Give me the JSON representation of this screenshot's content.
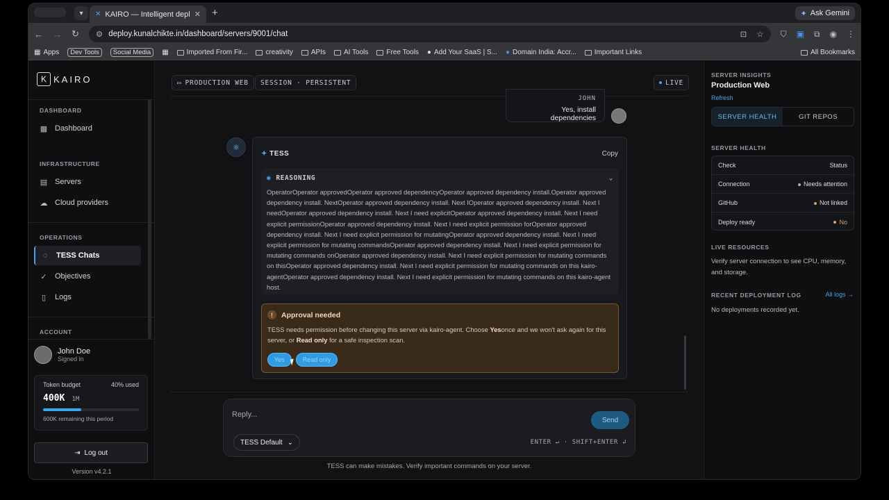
{
  "browser": {
    "tab_title": "KAIRO — Intelligent deployment",
    "new_tab": "+",
    "ask_gemini": "Ask Gemini",
    "url": "deploy.kunalchikte.in/dashboard/servers/9001/chat"
  },
  "bookmarks": {
    "items": [
      "Apps",
      "Dev Tools",
      "Social Media",
      "Imported From Fir...",
      "creativity",
      "APIs",
      "AI Tools",
      "Free Tools",
      "Add Your SaaS | S...",
      "Domain India: Accr...",
      "Important Links"
    ],
    "all": "All Bookmarks"
  },
  "sidebar": {
    "logo": "KAIRO",
    "logo_mark": "K",
    "sections": {
      "dashboard": "DASHBOARD",
      "infrastructure": "INFRASTRUCTURE",
      "operations": "OPERATIONS",
      "account": "ACCOUNT"
    },
    "items": {
      "dashboard": "Dashboard",
      "servers": "Servers",
      "cloud": "Cloud providers",
      "tess": "TESS Chats",
      "objectives": "Objectives",
      "logs": "Logs"
    },
    "user": {
      "name": "John Doe",
      "status": "Signed in"
    },
    "budget": {
      "label": "Token budget",
      "used": "40% used",
      "used_fraction": 0.4,
      "value": "400K",
      "limit": "1M",
      "remaining": "600K remaining this period"
    },
    "logout": "Log out",
    "version": "Version v4.2.1"
  },
  "main": {
    "chip_server": "PRODUCTION WEB",
    "chip_session": "SESSION · PERSISTENT",
    "chip_live": "LIVE",
    "user_msg": {
      "name": "JOHN",
      "text": "Yes, install dependencies"
    },
    "assistant": {
      "name": "TESS",
      "copy": "Copy",
      "reasoning_label": "REASONING",
      "reasoning_text": "OperatorOperator approvedOperator approved dependencyOperator approved dependency install.Operator approved dependency install. NextOperator approved dependency install. Next IOperator approved dependency install. Next I needOperator approved dependency install. Next I need explicitOperator approved dependency install. Next I need explicit permissionOperator approved dependency install. Next I need explicit permission forOperator approved dependency install. Next I need explicit permission for mutatingOperator approved dependency install. Next I need explicit permission for mutating commandsOperator approved dependency install. Next I need explicit permission for mutating commands onOperator approved dependency install. Next I need explicit permission for mutating commands on thisOperator approved dependency install. Next I need explicit permission for mutating commands on this kairo-agentOperator approved dependency install. Next I need explicit permission for mutating commands on this kairo-agent host.",
      "approval": {
        "title": "Approval needed",
        "text_1": "TESS needs permission before changing this server via kairo-agent. Choose ",
        "text_yes": "Yes",
        "text_2": "once and we won't ask again for this server, or ",
        "text_readonly": "Read only",
        "text_3": " for a safe inspection scan.",
        "btn_yes": "Yes",
        "btn_readonly": "Read only"
      }
    },
    "composer": {
      "placeholder": "Reply...",
      "send": "Send",
      "model": "TESS Default",
      "hints": "ENTER ↵ · SHIFT+ENTER ↲"
    },
    "disclaimer": "TESS can make mistakes. Verify important commands on your server."
  },
  "right": {
    "eyebrow": "SERVER INSIGHTS",
    "title": "Production Web",
    "refresh": "Refresh",
    "tab_health": "SERVER HEALTH",
    "tab_git": "GIT REPOS",
    "health_title": "SERVER HEALTH",
    "health_header": {
      "check": "Check",
      "status": "Status"
    },
    "health_rows": [
      {
        "check": "Connection",
        "status": "Needs attention"
      },
      {
        "check": "GitHub",
        "status": "Not linked"
      },
      {
        "check": "Deploy ready",
        "status": "No"
      }
    ],
    "live_title": "LIVE RESOURCES",
    "live_text": "Verify server connection to see CPU, memory, and storage.",
    "deploy_title": "RECENT DEPLOYMENT LOG",
    "all_logs": "All logs →",
    "deploy_text": "No deployments recorded yet."
  },
  "colors": {
    "accent": "#4aa3e6",
    "warning": "#d9a35a",
    "live": "#4aa3e6"
  }
}
